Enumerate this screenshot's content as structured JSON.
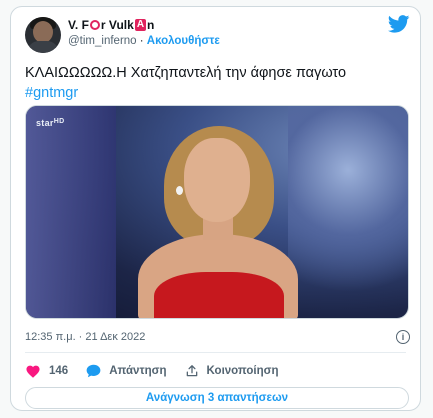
{
  "author": {
    "name_prefix": "V. F",
    "name_mid": "r Vulk",
    "name_glyph_a": "A",
    "name_suffix": "n",
    "handle": "@tim_inferno",
    "follow_label": "Ακολουθήστε"
  },
  "tweet": {
    "text": "ΚΛΑΙΩΩΩΩΩ.Η Χατζηπαντελή την άφησε παγωτο",
    "hashtag": "#gntmgr",
    "timestamp": "12:35 π.μ. · 21 Δεκ 2022"
  },
  "media": {
    "watermark_main": "star",
    "watermark_sub": "HD"
  },
  "actions": {
    "like_count": "146",
    "reply_label": "Απάντηση",
    "share_label": "Κοινοποίηση",
    "read_replies_label": "Ανάγνωση 3 απαντήσεων"
  },
  "colors": {
    "accent": "#1d9bf0",
    "like": "#f91880",
    "muted": "#536471"
  }
}
